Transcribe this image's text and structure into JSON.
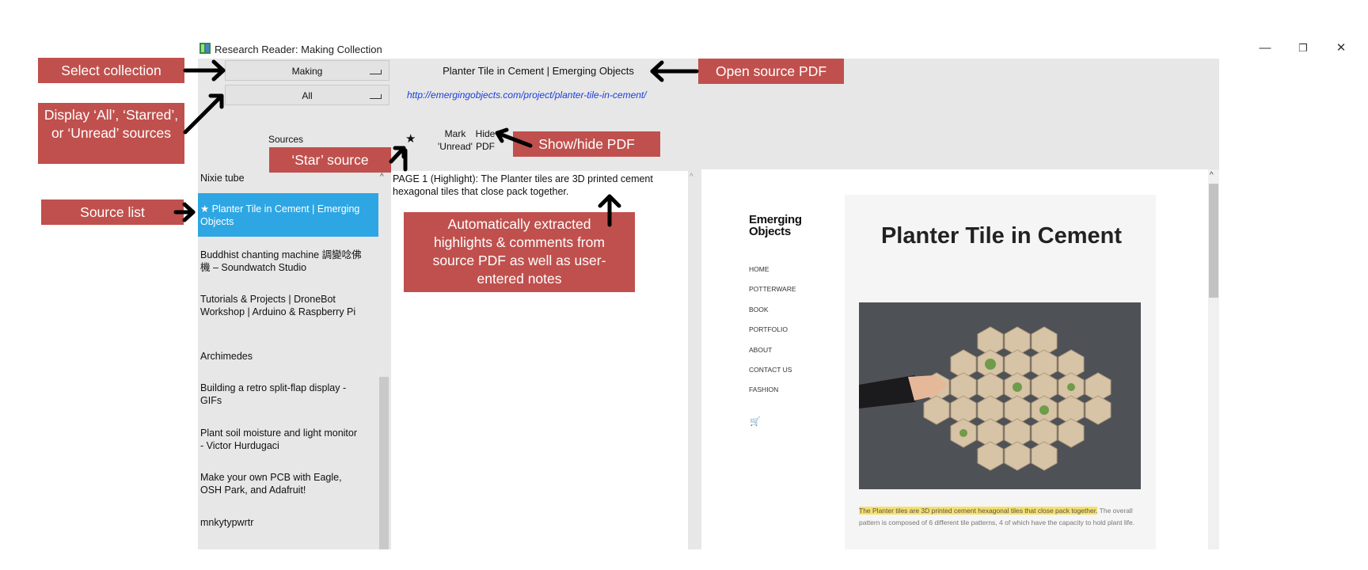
{
  "window": {
    "title": "Research Reader: Making Collection",
    "controls": {
      "minimize": "—",
      "restore": "❐",
      "close": "✕"
    }
  },
  "collection_select": {
    "value": "Making"
  },
  "filter_select": {
    "value": "All"
  },
  "source": {
    "title": "Planter Tile in Cement | Emerging Objects",
    "url": "http://emergingobjects.com/project/planter-tile-in-cement/"
  },
  "column_headers": {
    "sources": "Sources",
    "star": "★",
    "mark_unread_line1": "Mark",
    "mark_unread_line2": "'Unread'",
    "hide_pdf_line1": "Hide",
    "hide_pdf_line2": "PDF"
  },
  "source_list": [
    {
      "label": "Nixie tube",
      "selected": false
    },
    {
      "label": "★ Planter Tile in Cement | Emerging Objects",
      "selected": true
    },
    {
      "label": "Buddhist chanting machine 調變唸佛機 – Soundwatch Studio",
      "selected": false
    },
    {
      "label": "Tutorials & Projects | DroneBot Workshop | Arduino & Raspberry Pi",
      "selected": false
    },
    {
      "label": "Archimedes",
      "selected": false
    },
    {
      "label": "Building a retro split-flap display - GIFs",
      "selected": false
    },
    {
      "label": "Plant soil moisture and light monitor - Victor Hurdugaci",
      "selected": false
    },
    {
      "label": "Make your own PCB with Eagle, OSH Park, and Adafruit!",
      "selected": false
    },
    {
      "label": "mnkytypwrtr",
      "selected": false
    }
  ],
  "notes": {
    "text": "PAGE 1 (Highlight):  The Planter tiles are 3D printed cement hexagonal tiles that close pack together."
  },
  "pdf": {
    "logo_line1": "Emerging",
    "logo_line2": "Objects",
    "nav": [
      "HOME",
      "POTTERWARE",
      "BOOK",
      "PORTFOLIO",
      "ABOUT",
      "CONTACT US",
      "FASHION"
    ],
    "cart_icon": "🛒",
    "heading": "Planter Tile in Cement",
    "paragraph_highlight": "The Planter tiles are 3D printed cement hexagonal tiles that close pack together.",
    "paragraph_rest": " The overall pattern is composed of 6 different tile patterns, 4 of which have the capacity to hold plant life."
  },
  "callouts": {
    "select_collection": "Select collection",
    "display_filter": "Display ‘All’, ‘Starred’, or ‘Unread’ sources",
    "source_list": "Source list",
    "star_source": "‘Star’ source",
    "open_source_pdf": "Open source PDF",
    "show_hide_pdf": "Show/hide PDF",
    "auto_extracted": "Automatically extracted highlights & comments from source PDF as well as user-entered notes"
  },
  "colors": {
    "callout_bg": "#c0504d",
    "selection_bg": "#2ea6e3",
    "link": "#1a3ddb",
    "highlight": "#f6e06b"
  }
}
